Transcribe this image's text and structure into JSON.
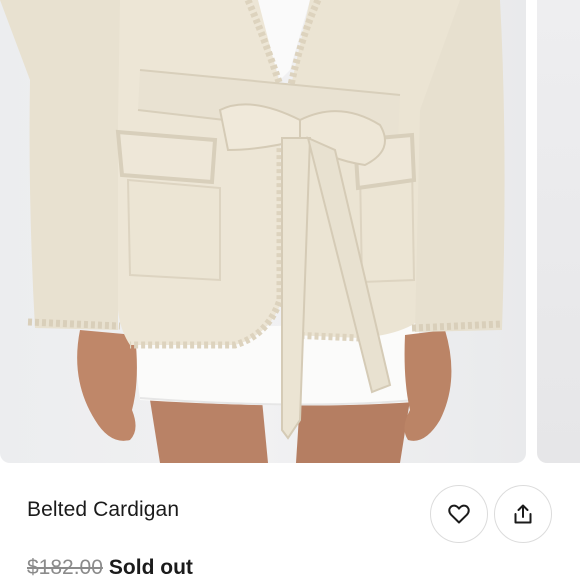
{
  "product": {
    "title": "Belted Cardigan",
    "original_price": "$182.00",
    "status": "Sold out"
  },
  "actions": {
    "like_icon": "heart-icon",
    "share_icon": "share-upload-icon"
  },
  "image": {
    "subject": "cream knit cardigan with tie belt over white skirt",
    "colors": {
      "knit": "#ede6d6",
      "background": "#eeeef0",
      "skin": "#b98266",
      "skirt": "#ffffff"
    }
  }
}
